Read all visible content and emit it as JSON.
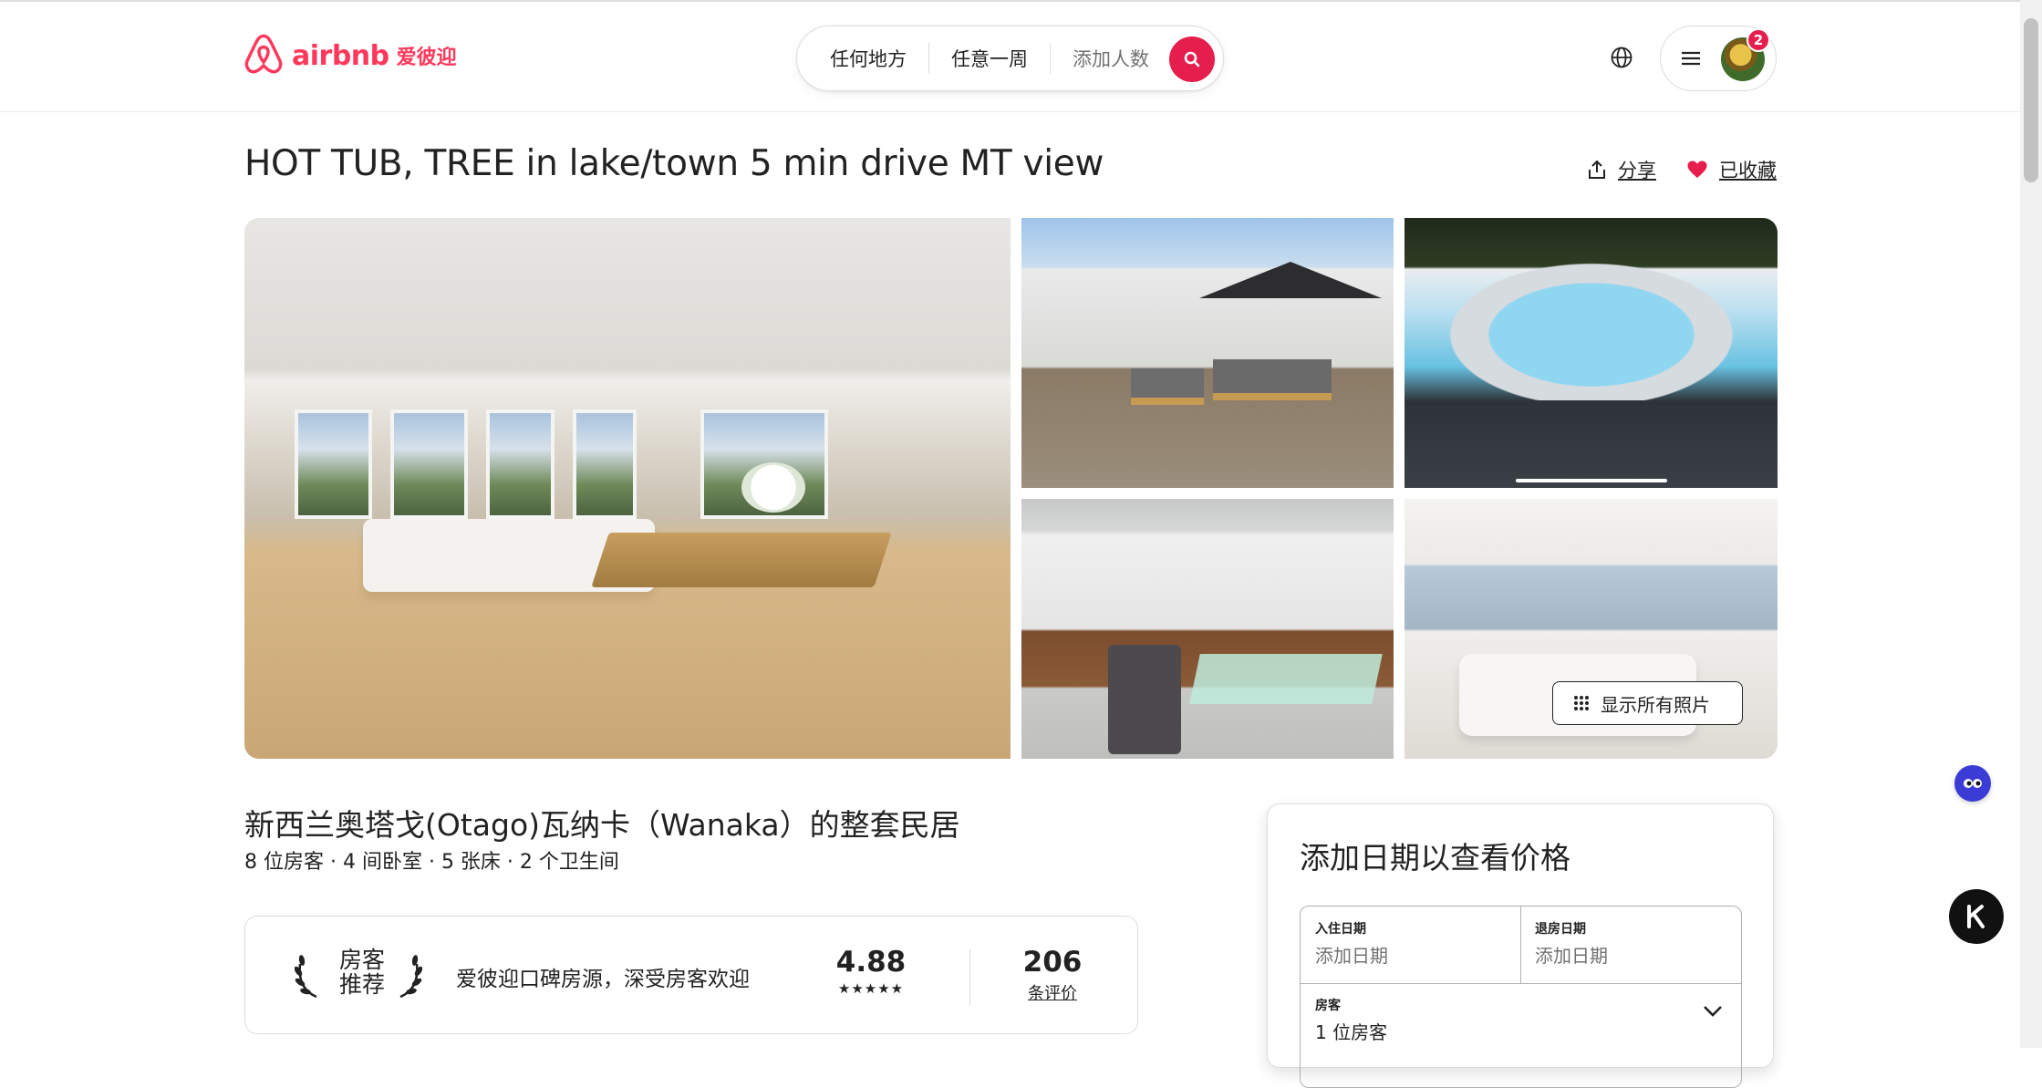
{
  "header": {
    "logo_word": "airbnb",
    "logo_cn": "爱彼迎",
    "search": {
      "anywhere": "任何地方",
      "any_week": "任意一周",
      "add_guests": "添加人数"
    },
    "notification_count": "2"
  },
  "listing": {
    "title": "HOT TUB, TREE in lake/town 5 min drive MT view",
    "share_label": "分享",
    "saved_label": "已收藏",
    "show_all_photos": "显示所有照片",
    "subtitle": "新西兰奥塔戈(Otago)瓦纳卡（Wanaka）的整套民居",
    "facts": "8 位房客 · 4 间卧室 · 5 张床 · 2 个卫生间"
  },
  "guest_favorite": {
    "badge_line1": "房客",
    "badge_line2": "推荐",
    "description": "爱彼迎口碑房源，深受房客欢迎",
    "rating": "4.88",
    "stars": "★★★★★",
    "review_count": "206",
    "review_label": "条评价"
  },
  "booking": {
    "title": "添加日期以查看价格",
    "checkin_label": "入住日期",
    "checkin_value": "添加日期",
    "checkout_label": "退房日期",
    "checkout_value": "添加日期",
    "guests_label": "房客",
    "guests_value": "1 位房客"
  },
  "colors": {
    "brand": "#ff385c",
    "search_button": "#e61e4d",
    "text": "#222222",
    "muted": "#717171"
  }
}
